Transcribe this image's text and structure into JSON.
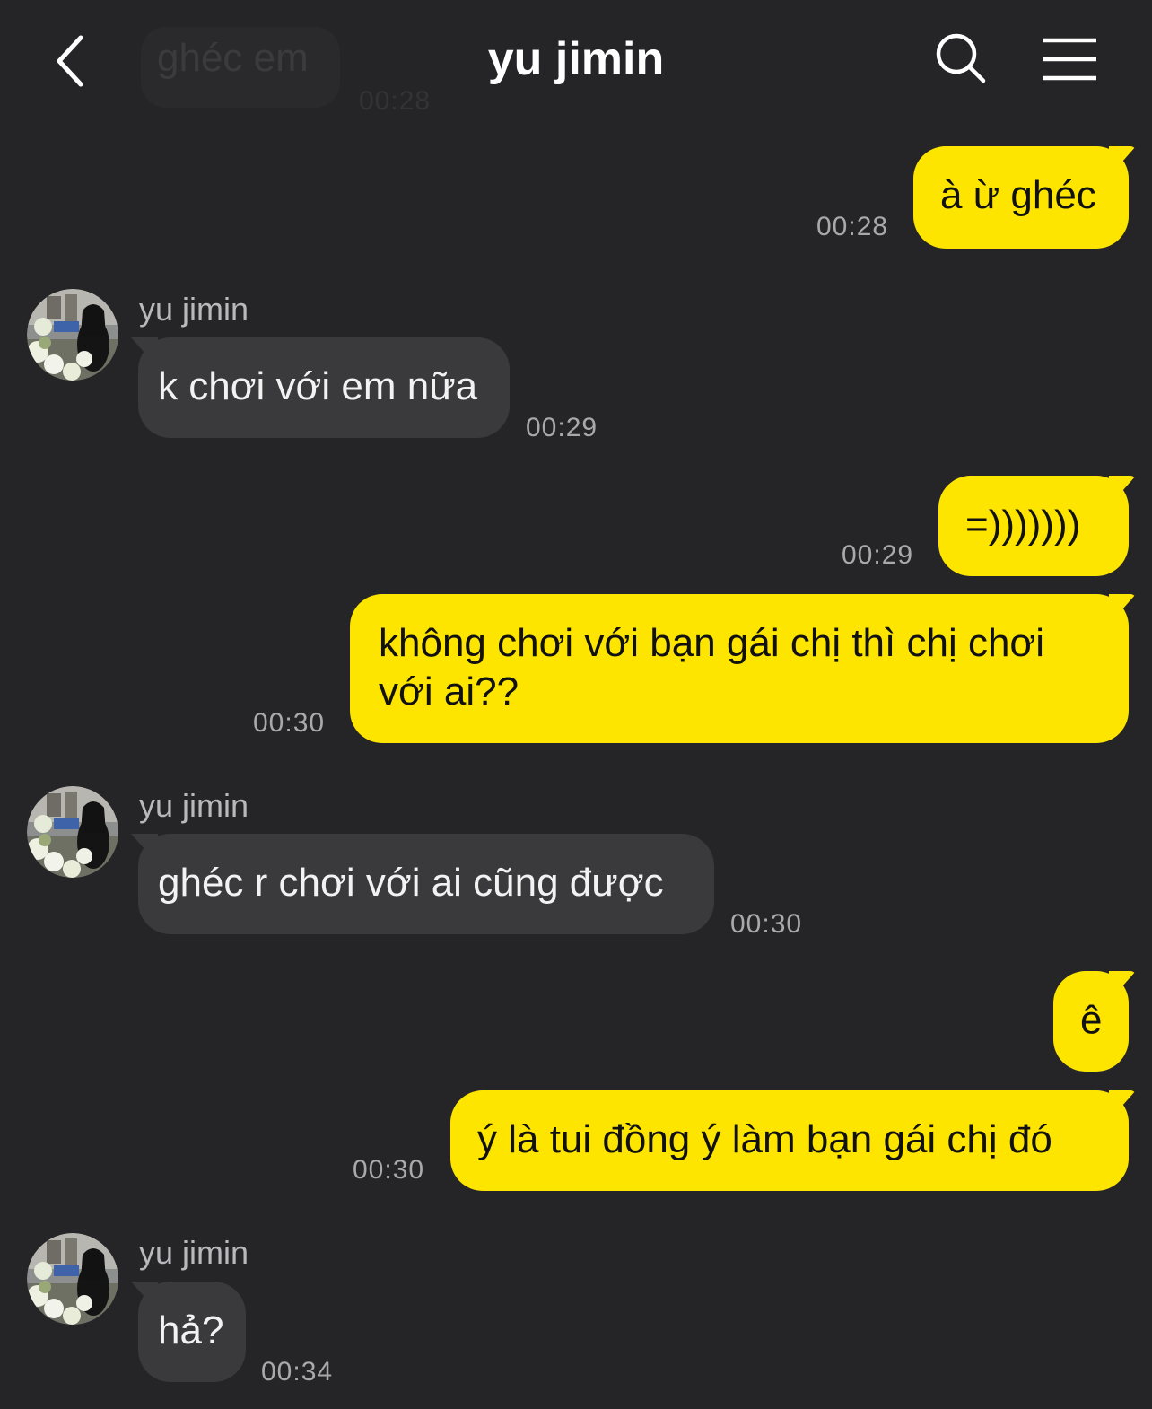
{
  "header": {
    "title": "yu jimin",
    "ghost_preview": {
      "text": "ghéc em",
      "time": "00:28"
    }
  },
  "colors": {
    "background": "#252527",
    "my_bubble": "#fee500",
    "their_bubble": "#3a3a3c"
  },
  "messages": [
    {
      "from": "me",
      "text": "à ừ ghéc",
      "time": "00:28"
    },
    {
      "from": "them",
      "sender": "yu jimin",
      "text": "k chơi với em nữa",
      "time": "00:29"
    },
    {
      "from": "me",
      "text": "=)))))))",
      "time": "00:29"
    },
    {
      "from": "me",
      "text": "không chơi với bạn gái chị thì chị chơi với ai??",
      "time": "00:30"
    },
    {
      "from": "them",
      "sender": "yu jimin",
      "text": "ghéc r chơi với ai cũng được",
      "time": "00:30"
    },
    {
      "from": "me",
      "text": "ê",
      "time": ""
    },
    {
      "from": "me",
      "text": "ý là tui đồng ý làm bạn gái chị đó",
      "time": "00:30"
    },
    {
      "from": "them",
      "sender": "yu jimin",
      "text": "hả?",
      "time": "00:34"
    }
  ]
}
